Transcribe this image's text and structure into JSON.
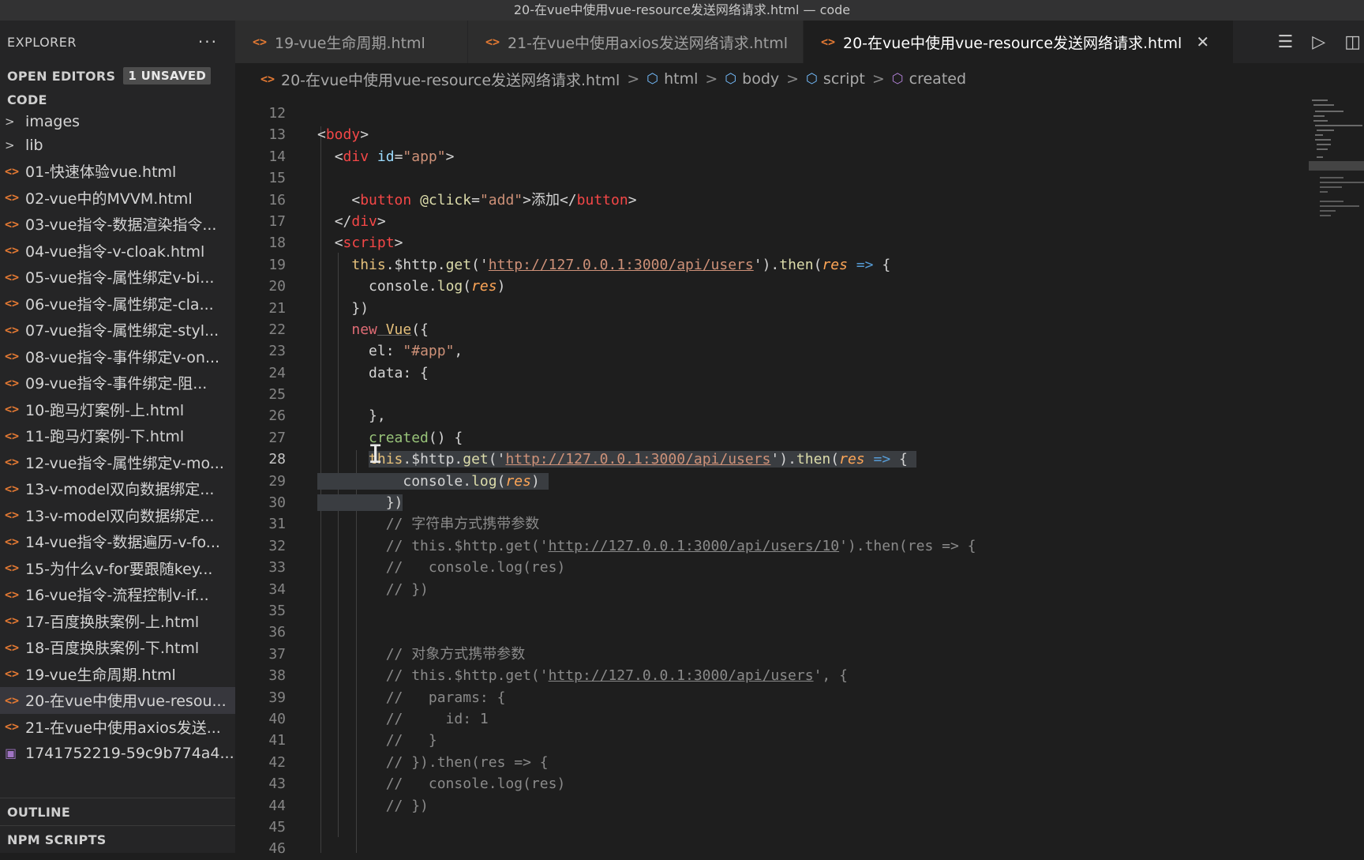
{
  "window_title": "20-在vue中使用vue-resource发送网络请求.html — code",
  "sidebar": {
    "title": "EXPLORER",
    "more": "···",
    "open_editors": "OPEN EDITORS",
    "unsaved_badge": "1 UNSAVED",
    "folder_title": "CODE",
    "folders": [
      "images",
      "lib"
    ],
    "files": [
      "01-快速体验vue.html",
      "02-vue中的MVVM.html",
      "03-vue指令-数据渲染指令...",
      "04-vue指令-v-cloak.html",
      "05-vue指令-属性绑定v-bi...",
      "06-vue指令-属性绑定-cla...",
      "07-vue指令-属性绑定-styl...",
      "08-vue指令-事件绑定v-on...",
      "09-vue指令-事件绑定-阻...",
      "10-跑马灯案例-上.html",
      "11-跑马灯案例-下.html",
      "12-vue指令-属性绑定v-mo...",
      "13-v-model双向数据绑定...",
      "13-v-model双向数据绑定...",
      "14-vue指令-数据遍历-v-fo...",
      "15-为什么v-for要跟随key...",
      "16-vue指令-流程控制v-if...",
      "17-百度换肤案例-上.html",
      "18-百度换肤案例-下.html",
      "19-vue生命周期.html",
      "20-在vue中使用vue-resou...",
      "21-在vue中使用axios发送..."
    ],
    "image_file": "1741752219-59c9b774a4...",
    "outline": "OUTLINE",
    "npm_scripts": "NPM SCRIPTS"
  },
  "tabs": [
    {
      "label": "19-vue生命周期.html"
    },
    {
      "label": "21-在vue中使用axios发送网络请求.html"
    },
    {
      "label": "20-在vue中使用vue-resource发送网络请求.html"
    }
  ],
  "tab_close": "✕",
  "breadcrumb": {
    "file": "20-在vue中使用vue-resource发送网络请求.html",
    "parts": [
      "html",
      "body",
      "script",
      "created"
    ]
  },
  "line_numbers": [
    "12",
    "13",
    "14",
    "15",
    "16",
    "17",
    "18",
    "19",
    "20",
    "21",
    "22",
    "23",
    "24",
    "25",
    "26",
    "27",
    "28",
    "29",
    "30",
    "31",
    "32",
    "33",
    "34",
    "35",
    "36",
    "37",
    "38",
    "39",
    "40",
    "41",
    "42",
    "43",
    "44",
    "45",
    "46"
  ],
  "code": {
    "l13": {
      "open": "<",
      "tag": "body",
      "close": ">"
    },
    "l14": {
      "open": "<",
      "tag": "div",
      "attr": " id",
      "eq": "=",
      "val": "\"app\"",
      "close": ">"
    },
    "l16": {
      "open": "<",
      "tag": "button",
      "attr": " @click",
      "eq": "=",
      "val": "\"add\"",
      "gt": ">",
      "text": "添加",
      "etag_open": "</",
      "etag": "button",
      "close": ">"
    },
    "l17": {
      "open": "</",
      "tag": "div",
      "close": ">"
    },
    "l18": {
      "open": "<",
      "tag": "script",
      "close": ">"
    },
    "l19": {
      "kw": "this",
      "a": ".$http.",
      "fn": "get",
      "b": "('",
      "url": "http://127.0.0.1:3000/api/users",
      "c": "').",
      "fn2": "then",
      "d": "(",
      "param": "res",
      "arrow": " =>",
      "e": " {"
    },
    "l20": {
      "a": "console.",
      "fn": "log",
      "b": "(",
      "param": "res",
      "c": ")"
    },
    "l21": {
      "a": "})"
    },
    "l22": {
      "kw": "new",
      "cls": " Vue",
      "a": "({"
    },
    "l23": {
      "a": "el: ",
      "str": "\"#app\"",
      "b": ","
    },
    "l24": {
      "a": "data: {"
    },
    "l26": {
      "a": "},"
    },
    "l27": {
      "fn": "created",
      "a": "() {"
    },
    "l28": {
      "kw": "this",
      "a": ".$http.",
      "fn": "get",
      "b": "('",
      "url": "http://127.0.0.1:3000/api/users",
      "c": "').",
      "fn2": "then",
      "d": "(",
      "param": "res",
      "arrow": " =>",
      "e": " {"
    },
    "l29": {
      "a": "console.",
      "fn": "log",
      "b": "(",
      "param": "res",
      "c": ")"
    },
    "l30": {
      "a": "})"
    },
    "l31": "// 字符串方式携带参数",
    "l32": {
      "a": "// this.$http.get('",
      "url": "http://127.0.0.1:3000/api/users/10",
      "b": "').then(res => {"
    },
    "l33": "//   console.log(res)",
    "l34": "// })",
    "l37": "// 对象方式携带参数",
    "l38": {
      "a": "// this.$http.get('",
      "url": "http://127.0.0.1:3000/api/users",
      "b": "', {"
    },
    "l39": "//   params: {",
    "l40": "//     id: 1",
    "l41": "//   }",
    "l42": "// }).then(res => {",
    "l43": "//   console.log(res)",
    "l44": "// })"
  },
  "colors": {
    "tag": "#f44747",
    "string": "#ce9178",
    "keyword": "#e5c07b",
    "function": "#dcdcaa",
    "param": "#ffa657",
    "comment": "#8a8a8a"
  }
}
